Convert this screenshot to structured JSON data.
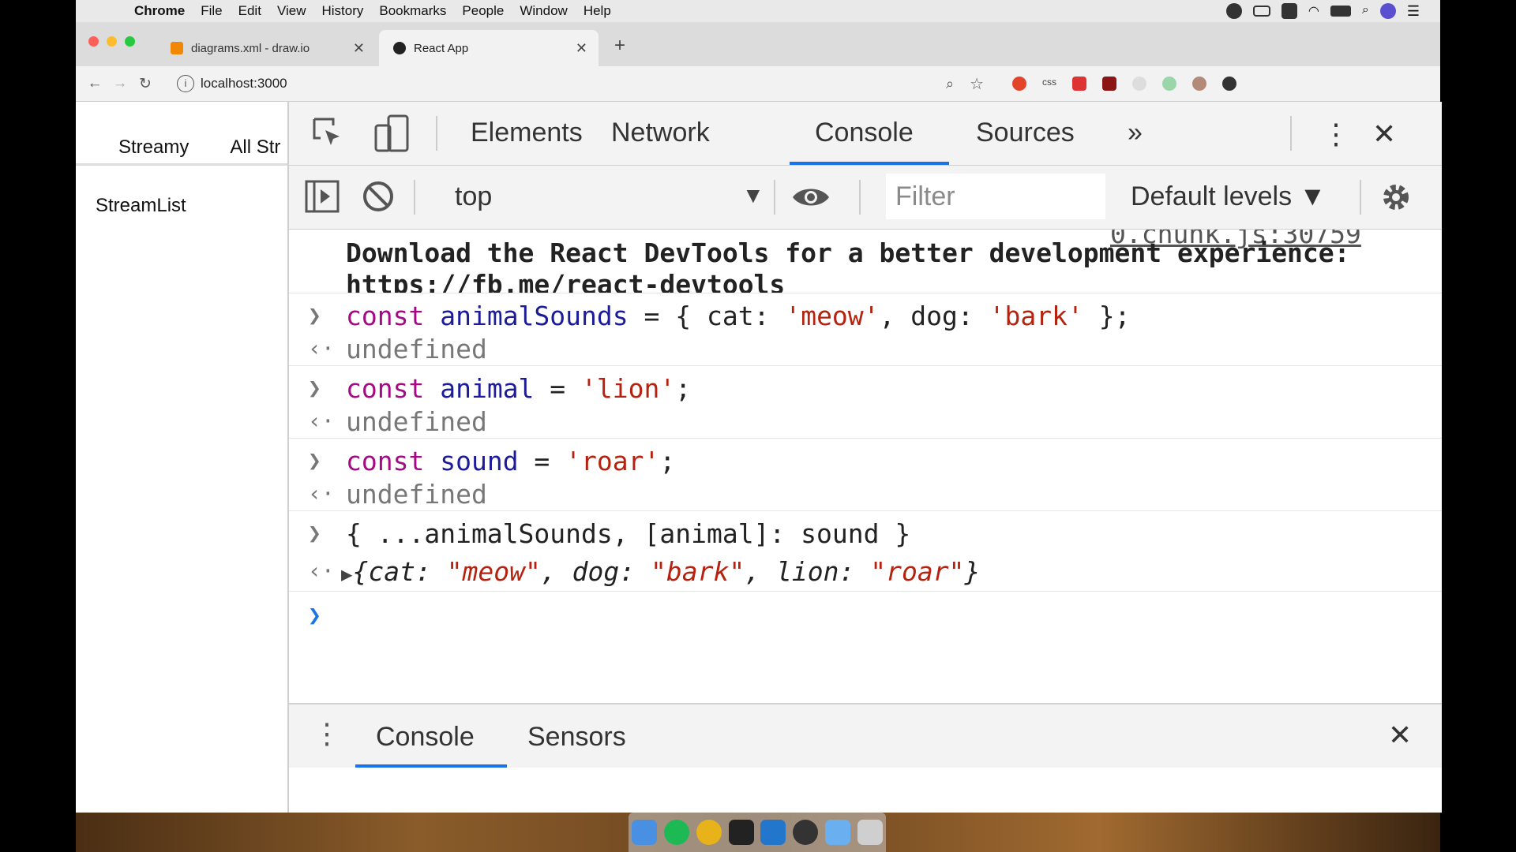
{
  "menubar": {
    "app": "Chrome",
    "items": [
      "File",
      "Edit",
      "View",
      "History",
      "Bookmarks",
      "People",
      "Window",
      "Help"
    ]
  },
  "browser": {
    "tabs": [
      {
        "title": "diagrams.xml - draw.io",
        "favicon": "drawio-icon",
        "color": "#f08705"
      },
      {
        "title": "React App",
        "favicon": "react-icon",
        "color": "#222"
      }
    ],
    "url": "localhost:3000"
  },
  "page": {
    "brand": "Streamy",
    "link": "All Str",
    "heading": "StreamList"
  },
  "devtools": {
    "tabs": [
      "Elements",
      "Network",
      "Console",
      "Sources"
    ],
    "more": "»",
    "active_tab": "Console",
    "context": "top",
    "filter_placeholder": "Filter",
    "levels": "Default levels ▼",
    "console": {
      "clipped_source": "0.chunk.js:30759",
      "download_msg": "Download the React DevTools for a better development experience: ",
      "download_url": "https://fb.me/react-devtools",
      "entries": [
        {
          "kw": "const",
          "var": "animalSounds",
          "rest1": " = { cat: ",
          "s1": "'meow'",
          "rest2": ", dog: ",
          "s2": "'bark'",
          "rest3": " };"
        },
        {
          "kw": "const",
          "var": "animal",
          "rest1": " = ",
          "s1": "'lion'",
          "rest2": ";"
        },
        {
          "kw": "const",
          "var": "sound",
          "rest1": " = ",
          "s1": "'roar'",
          "rest2": ";"
        }
      ],
      "undefined": "undefined",
      "spread_input": "{ ...animalSounds, [animal]: sound }",
      "result": {
        "k1": "cat",
        "v1": "\"meow\"",
        "k2": "dog",
        "v2": "\"bark\"",
        "k3": "lion",
        "v3": "\"roar\""
      }
    },
    "drawer_tabs": [
      "Console",
      "Sensors"
    ]
  },
  "colors": {
    "accent": "#1a73e8",
    "keyword": "#a40a83",
    "string": "#b5220f",
    "variable": "#1c1c9a"
  }
}
